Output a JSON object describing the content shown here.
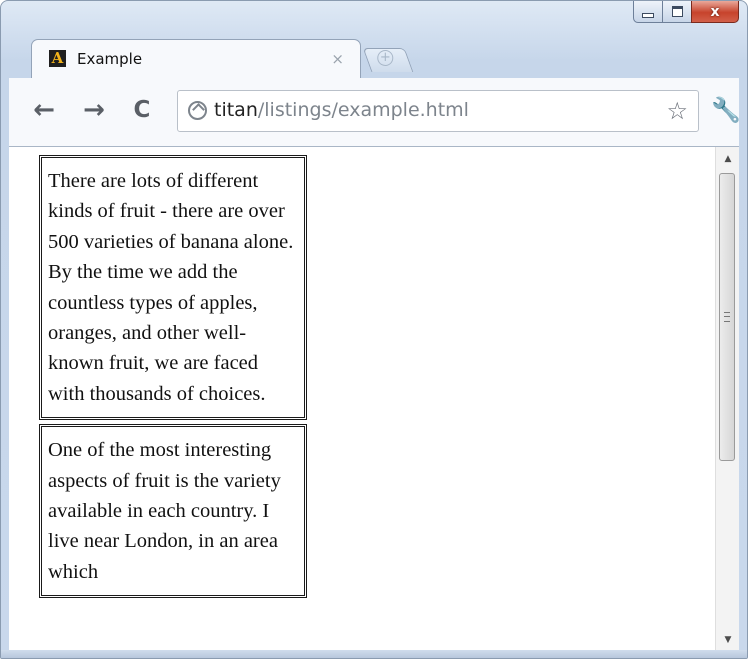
{
  "window": {
    "caption_buttons": {
      "minimize_icon": "minimize-icon",
      "maximize_icon": "maximize-icon",
      "close_label": "x"
    }
  },
  "tabs": [
    {
      "title": "Example",
      "favicon_letter": "A",
      "close_label": "×"
    }
  ],
  "new_tab_icon": "+",
  "toolbar": {
    "back_icon": "←",
    "forward_icon": "→",
    "reload_icon": "C",
    "url_host": "titan",
    "url_path": "/listings/example.html",
    "star_icon": "☆",
    "wrench_icon": "🔧"
  },
  "content": {
    "paragraphs": [
      "There are lots of different kinds of fruit - there are over 500 varieties of banana alone. By the time we add the countless types of apples, oranges, and other well-known fruit, we are faced with thousands of choices.",
      "One of the most interesting aspects of fruit is the variety available in each country. I live near London, in an area which"
    ]
  },
  "scrollbar": {
    "up_arrow": "▲",
    "down_arrow": "▼"
  },
  "colors": {
    "frame": "#c6d6ea",
    "close_button": "#c7432c",
    "url_path": "#7d848c"
  }
}
